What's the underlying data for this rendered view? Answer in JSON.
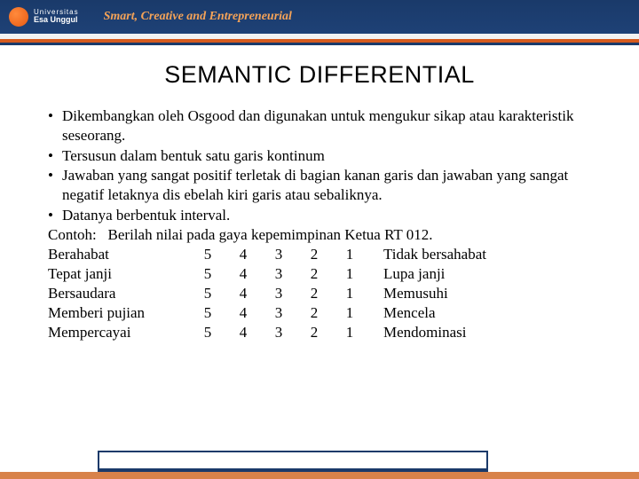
{
  "header": {
    "logo_line1": "Universitas",
    "logo_line2": "Esa Unggul",
    "tagline": "Smart, Creative and Entrepreneurial"
  },
  "title": "SEMANTIC DIFFERENTIAL",
  "bullets": [
    "Dikembangkan oleh Osgood dan digunakan untuk mengukur sikap atau karakteristik seseorang.",
    "Tersusun dalam bentuk satu garis kontinum",
    "Jawaban yang sangat positif terletak di bagian kanan garis dan jawaban yang sangat negatif letaknya dis ebelah kiri garis atau sebaliknya.",
    "Datanya berbentuk interval."
  ],
  "contoh_label": "Contoh:",
  "contoh_text": "Berilah nilai pada gaya kepemimpinan Ketua RT 012.",
  "scale": {
    "numbers": [
      "5",
      "4",
      "3",
      "2",
      "1"
    ],
    "rows": [
      {
        "left": "Berahabat",
        "right": "Tidak bersahabat"
      },
      {
        "left": "Tepat janji",
        "right": "Lupa janji"
      },
      {
        "left": "Bersaudara",
        "right": "Memusuhi"
      },
      {
        "left": "Memberi pujian",
        "right": "Mencela"
      },
      {
        "left": "Mempercayai",
        "right": "Mendominasi"
      }
    ]
  }
}
